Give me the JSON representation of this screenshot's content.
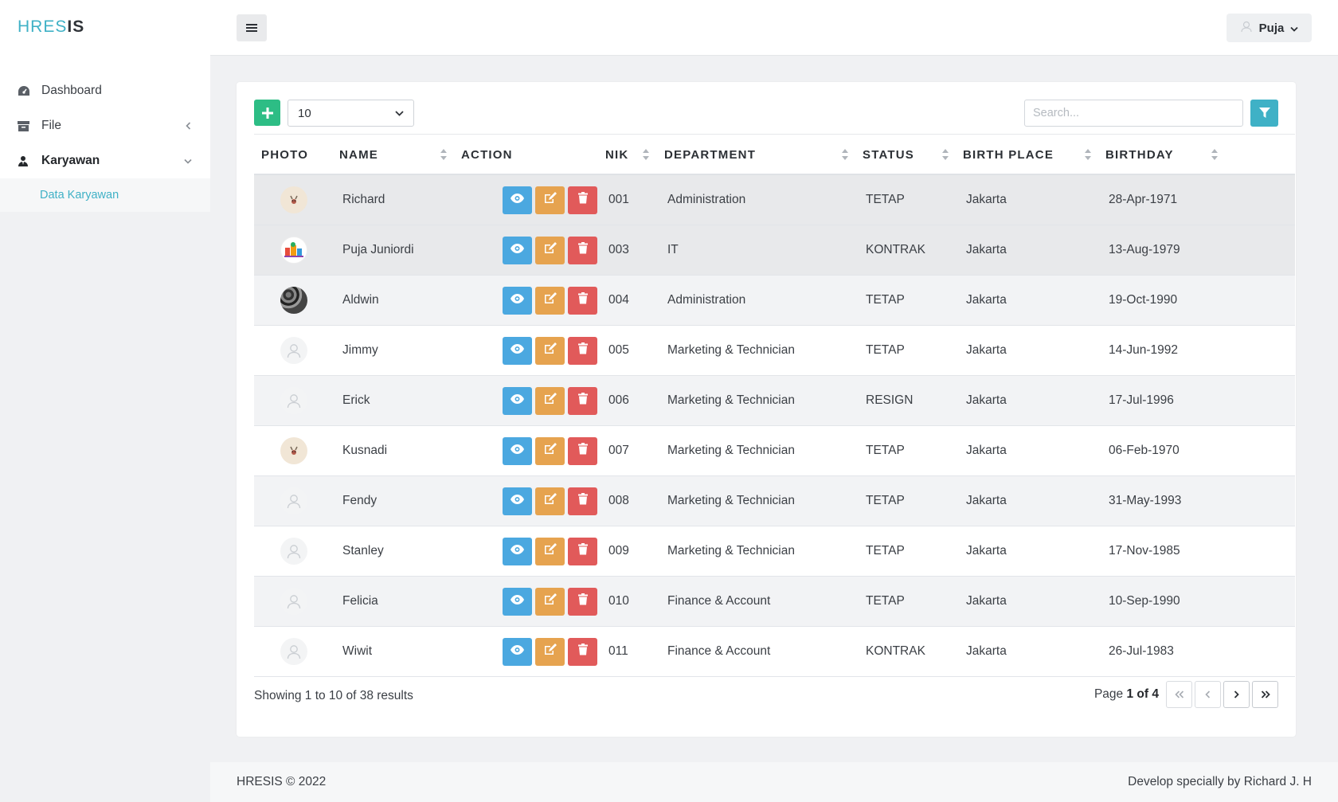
{
  "brand": {
    "part1": "HRES",
    "part2": "IS"
  },
  "sidebar": {
    "items": [
      {
        "label": "Dashboard",
        "icon": "dashboard-gauge-icon"
      },
      {
        "label": "File",
        "icon": "archive-box-icon"
      },
      {
        "label": "Karyawan",
        "icon": "user-group-icon"
      }
    ],
    "subitems": [
      {
        "label": "Data Karyawan"
      }
    ]
  },
  "topbar": {
    "user_name": "Puja"
  },
  "toolbar": {
    "per_page": "10",
    "search_placeholder": "Search..."
  },
  "table": {
    "headers": {
      "photo": "PHOTO",
      "name": "NAME",
      "action": "ACTION",
      "nik": "NIK",
      "department": "DEPARTMENT",
      "status": "STATUS",
      "birth_place": "BIRTH PLACE",
      "birthday": "BIRTHDAY"
    },
    "rows": [
      {
        "name": "Richard",
        "nik": "001",
        "department": "Administration",
        "status": "TETAP",
        "birth_place": "Jakarta",
        "birthday": "28-Apr-1971",
        "avatar": "cat"
      },
      {
        "name": "Puja Juniordi",
        "nik": "003",
        "department": "IT",
        "status": "KONTRAK",
        "birth_place": "Jakarta",
        "birthday": "13-Aug-1979",
        "avatar": "toys"
      },
      {
        "name": "Aldwin",
        "nik": "004",
        "department": "Administration",
        "status": "TETAP",
        "birth_place": "Jakarta",
        "birthday": "19-Oct-1990",
        "avatar": "noise"
      },
      {
        "name": "Jimmy",
        "nik": "005",
        "department": "Marketing & Technician",
        "status": "TETAP",
        "birth_place": "Jakarta",
        "birthday": "14-Jun-1992",
        "avatar": "blank"
      },
      {
        "name": "Erick",
        "nik": "006",
        "department": "Marketing & Technician",
        "status": "RESIGN",
        "birth_place": "Jakarta",
        "birthday": "17-Jul-1996",
        "avatar": "blank"
      },
      {
        "name": "Kusnadi",
        "nik": "007",
        "department": "Marketing & Technician",
        "status": "TETAP",
        "birth_place": "Jakarta",
        "birthday": "06-Feb-1970",
        "avatar": "cat"
      },
      {
        "name": "Fendy",
        "nik": "008",
        "department": "Marketing & Technician",
        "status": "TETAP",
        "birth_place": "Jakarta",
        "birthday": "31-May-1993",
        "avatar": "blank"
      },
      {
        "name": "Stanley",
        "nik": "009",
        "department": "Marketing & Technician",
        "status": "TETAP",
        "birth_place": "Jakarta",
        "birthday": "17-Nov-1985",
        "avatar": "blank"
      },
      {
        "name": "Felicia",
        "nik": "010",
        "department": "Finance & Account",
        "status": "TETAP",
        "birth_place": "Jakarta",
        "birthday": "10-Sep-1990",
        "avatar": "blank"
      },
      {
        "name": "Wiwit",
        "nik": "011",
        "department": "Finance & Account",
        "status": "KONTRAK",
        "birth_place": "Jakarta",
        "birthday": "26-Jul-1983",
        "avatar": "blank"
      }
    ]
  },
  "summary": "Showing 1 to 10 of 38 results",
  "pagination": {
    "prefix": "Page",
    "current": "1",
    "of": "of",
    "total": "4"
  },
  "footer": {
    "left": "HRESIS © 2022",
    "right": "Develop specially by Richard J. H"
  },
  "colors": {
    "accent": "#3fb1c6",
    "add": "#2dbd85",
    "view": "#4ba8e0",
    "edit": "#e6a34f",
    "delete": "#e15a5a"
  }
}
